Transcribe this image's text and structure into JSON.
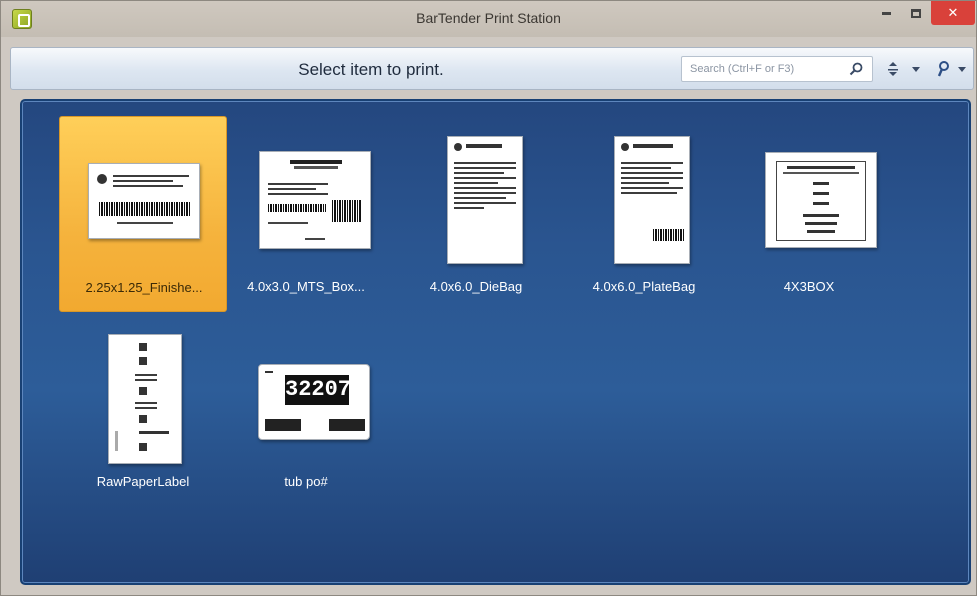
{
  "window": {
    "title": "BarTender Print Station",
    "accent": "#d9413a"
  },
  "toolbar": {
    "prompt": "Select item to print.",
    "search_placeholder": "Search (Ctrl+F or F3)"
  },
  "items": [
    {
      "label": "2.25x1.25_Finishe...",
      "selected": true,
      "thumb_icon": "label-landscape-icon"
    },
    {
      "label": "4.0x3.0_MTS_Box...",
      "selected": false,
      "thumb_icon": "label-box-icon"
    },
    {
      "label": "4.0x6.0_DieBag",
      "selected": false,
      "thumb_icon": "label-portrait-icon"
    },
    {
      "label": "4.0x6.0_PlateBag",
      "selected": false,
      "thumb_icon": "label-portrait-icon"
    },
    {
      "label": "4X3BOX",
      "selected": false,
      "thumb_icon": "label-box-icon"
    },
    {
      "label": "RawPaperLabel",
      "selected": false,
      "thumb_icon": "label-tall-icon"
    },
    {
      "label": "tub po#",
      "selected": false,
      "thumb_icon": "label-number-icon"
    }
  ],
  "tub_number": "32207"
}
